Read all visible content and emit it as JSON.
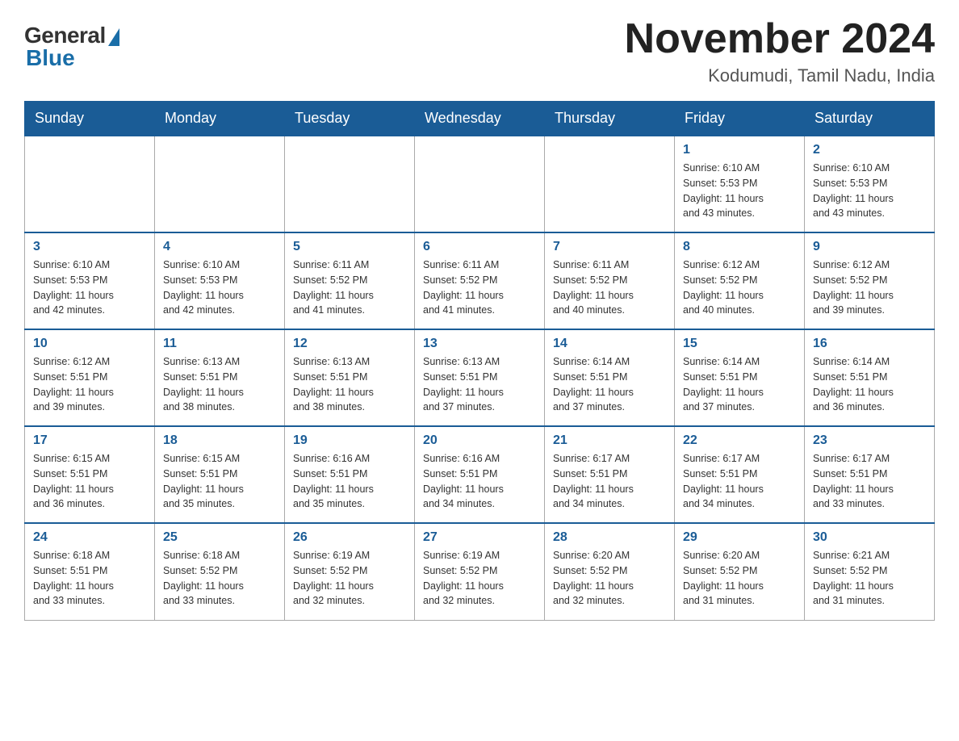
{
  "header": {
    "logo_general": "General",
    "logo_blue": "Blue",
    "month_title": "November 2024",
    "location": "Kodumudi, Tamil Nadu, India"
  },
  "days_of_week": [
    "Sunday",
    "Monday",
    "Tuesday",
    "Wednesday",
    "Thursday",
    "Friday",
    "Saturday"
  ],
  "weeks": [
    {
      "days": [
        {
          "number": "",
          "info": ""
        },
        {
          "number": "",
          "info": ""
        },
        {
          "number": "",
          "info": ""
        },
        {
          "number": "",
          "info": ""
        },
        {
          "number": "",
          "info": ""
        },
        {
          "number": "1",
          "info": "Sunrise: 6:10 AM\nSunset: 5:53 PM\nDaylight: 11 hours\nand 43 minutes."
        },
        {
          "number": "2",
          "info": "Sunrise: 6:10 AM\nSunset: 5:53 PM\nDaylight: 11 hours\nand 43 minutes."
        }
      ]
    },
    {
      "days": [
        {
          "number": "3",
          "info": "Sunrise: 6:10 AM\nSunset: 5:53 PM\nDaylight: 11 hours\nand 42 minutes."
        },
        {
          "number": "4",
          "info": "Sunrise: 6:10 AM\nSunset: 5:53 PM\nDaylight: 11 hours\nand 42 minutes."
        },
        {
          "number": "5",
          "info": "Sunrise: 6:11 AM\nSunset: 5:52 PM\nDaylight: 11 hours\nand 41 minutes."
        },
        {
          "number": "6",
          "info": "Sunrise: 6:11 AM\nSunset: 5:52 PM\nDaylight: 11 hours\nand 41 minutes."
        },
        {
          "number": "7",
          "info": "Sunrise: 6:11 AM\nSunset: 5:52 PM\nDaylight: 11 hours\nand 40 minutes."
        },
        {
          "number": "8",
          "info": "Sunrise: 6:12 AM\nSunset: 5:52 PM\nDaylight: 11 hours\nand 40 minutes."
        },
        {
          "number": "9",
          "info": "Sunrise: 6:12 AM\nSunset: 5:52 PM\nDaylight: 11 hours\nand 39 minutes."
        }
      ]
    },
    {
      "days": [
        {
          "number": "10",
          "info": "Sunrise: 6:12 AM\nSunset: 5:51 PM\nDaylight: 11 hours\nand 39 minutes."
        },
        {
          "number": "11",
          "info": "Sunrise: 6:13 AM\nSunset: 5:51 PM\nDaylight: 11 hours\nand 38 minutes."
        },
        {
          "number": "12",
          "info": "Sunrise: 6:13 AM\nSunset: 5:51 PM\nDaylight: 11 hours\nand 38 minutes."
        },
        {
          "number": "13",
          "info": "Sunrise: 6:13 AM\nSunset: 5:51 PM\nDaylight: 11 hours\nand 37 minutes."
        },
        {
          "number": "14",
          "info": "Sunrise: 6:14 AM\nSunset: 5:51 PM\nDaylight: 11 hours\nand 37 minutes."
        },
        {
          "number": "15",
          "info": "Sunrise: 6:14 AM\nSunset: 5:51 PM\nDaylight: 11 hours\nand 37 minutes."
        },
        {
          "number": "16",
          "info": "Sunrise: 6:14 AM\nSunset: 5:51 PM\nDaylight: 11 hours\nand 36 minutes."
        }
      ]
    },
    {
      "days": [
        {
          "number": "17",
          "info": "Sunrise: 6:15 AM\nSunset: 5:51 PM\nDaylight: 11 hours\nand 36 minutes."
        },
        {
          "number": "18",
          "info": "Sunrise: 6:15 AM\nSunset: 5:51 PM\nDaylight: 11 hours\nand 35 minutes."
        },
        {
          "number": "19",
          "info": "Sunrise: 6:16 AM\nSunset: 5:51 PM\nDaylight: 11 hours\nand 35 minutes."
        },
        {
          "number": "20",
          "info": "Sunrise: 6:16 AM\nSunset: 5:51 PM\nDaylight: 11 hours\nand 34 minutes."
        },
        {
          "number": "21",
          "info": "Sunrise: 6:17 AM\nSunset: 5:51 PM\nDaylight: 11 hours\nand 34 minutes."
        },
        {
          "number": "22",
          "info": "Sunrise: 6:17 AM\nSunset: 5:51 PM\nDaylight: 11 hours\nand 34 minutes."
        },
        {
          "number": "23",
          "info": "Sunrise: 6:17 AM\nSunset: 5:51 PM\nDaylight: 11 hours\nand 33 minutes."
        }
      ]
    },
    {
      "days": [
        {
          "number": "24",
          "info": "Sunrise: 6:18 AM\nSunset: 5:51 PM\nDaylight: 11 hours\nand 33 minutes."
        },
        {
          "number": "25",
          "info": "Sunrise: 6:18 AM\nSunset: 5:52 PM\nDaylight: 11 hours\nand 33 minutes."
        },
        {
          "number": "26",
          "info": "Sunrise: 6:19 AM\nSunset: 5:52 PM\nDaylight: 11 hours\nand 32 minutes."
        },
        {
          "number": "27",
          "info": "Sunrise: 6:19 AM\nSunset: 5:52 PM\nDaylight: 11 hours\nand 32 minutes."
        },
        {
          "number": "28",
          "info": "Sunrise: 6:20 AM\nSunset: 5:52 PM\nDaylight: 11 hours\nand 32 minutes."
        },
        {
          "number": "29",
          "info": "Sunrise: 6:20 AM\nSunset: 5:52 PM\nDaylight: 11 hours\nand 31 minutes."
        },
        {
          "number": "30",
          "info": "Sunrise: 6:21 AM\nSunset: 5:52 PM\nDaylight: 11 hours\nand 31 minutes."
        }
      ]
    }
  ]
}
